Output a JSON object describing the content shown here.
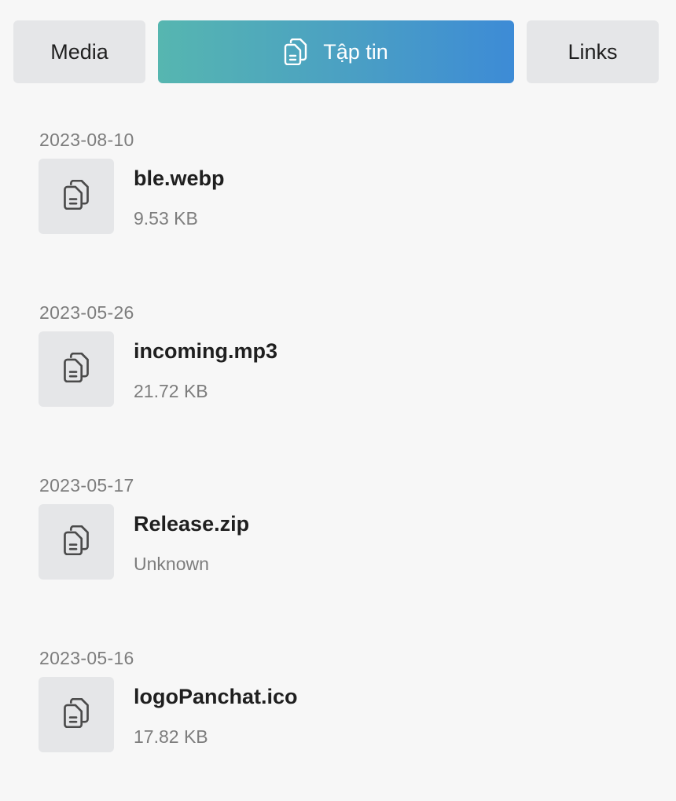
{
  "tabs": {
    "media_label": "Media",
    "files_label": "Tập tin",
    "links_label": "Links",
    "active": "files",
    "active_gradient": [
      "#56b6b0",
      "#3d8bd6"
    ]
  },
  "file_groups": [
    {
      "date": "2023-08-10",
      "file": {
        "name": "ble.webp",
        "size": "9.53 KB",
        "icon": "file-copy-icon"
      }
    },
    {
      "date": "2023-05-26",
      "file": {
        "name": "incoming.mp3",
        "size": "21.72 KB",
        "icon": "file-copy-icon"
      }
    },
    {
      "date": "2023-05-17",
      "file": {
        "name": "Release.zip",
        "size": "Unknown",
        "icon": "file-copy-icon"
      }
    },
    {
      "date": "2023-05-16",
      "file": {
        "name": "logoPanchat.ico",
        "size": "17.82 KB",
        "icon": "file-copy-icon"
      }
    }
  ]
}
